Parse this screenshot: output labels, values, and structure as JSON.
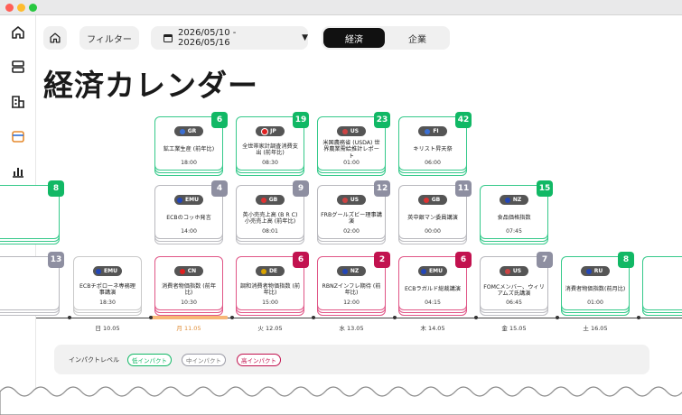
{
  "toolbar": {
    "filter_label": "フィルター",
    "date_range": "2026/05/10 - 2026/05/16",
    "segments": [
      "経済",
      "企業"
    ]
  },
  "page_title": "経済カレンダー",
  "colors": {
    "low": "#11b865",
    "mid": "#8e8fa1",
    "high": "#c2124f",
    "selected_day": "#f7b777"
  },
  "rows": {
    "row1": [
      {
        "flag": "GR",
        "flag_color": "#3b6fd3",
        "title": "鉱工業生産 (前年比)",
        "time": "18:00",
        "count": "6",
        "impact": "low"
      },
      {
        "flag": "JP",
        "flag_color": "#e02020",
        "title": "全世帯家計調査消費支出 (前年比)",
        "time": "08:30",
        "count": "19",
        "impact": "low"
      },
      {
        "flag": "US",
        "flag_color": "#c44",
        "title": "米国農務省 (USDA) 世界農業需給推計レポート",
        "time": "01:00",
        "count": "23",
        "impact": "low"
      },
      {
        "flag": "FI",
        "flag_color": "#3b6fd3",
        "title": "キリスト昇天祭",
        "time": "06:00",
        "count": "42",
        "impact": "low"
      }
    ],
    "row2": [
      {
        "flag": "",
        "flag_color": "#555",
        "title": "",
        "time": "",
        "count": "8",
        "impact": "low"
      },
      {
        "flag": "EMU",
        "flag_color": "#2346b7",
        "title": "ECBのコッホ発言",
        "time": "14:00",
        "count": "4",
        "impact": "mid"
      },
      {
        "flag": "GB",
        "flag_color": "#d33",
        "title": "英小売売上高 (B R C) 小売売上高 (前年比)",
        "time": "08:01",
        "count": "9",
        "impact": "mid"
      },
      {
        "flag": "US",
        "flag_color": "#c44",
        "title": "FRBグールズビー理事講演",
        "time": "02:00",
        "count": "12",
        "impact": "mid"
      },
      {
        "flag": "GB",
        "flag_color": "#d33",
        "title": "英中銀マン委員講演",
        "time": "00:00",
        "count": "11",
        "impact": "mid"
      },
      {
        "flag": "NZ",
        "flag_color": "#2346b7",
        "title": "食品価格指数",
        "time": "07:45",
        "count": "15",
        "impact": "low"
      }
    ],
    "row3": [
      {
        "flag": "",
        "flag_color": "#555",
        "title": "",
        "time": "",
        "count": "13",
        "impact": "mid"
      },
      {
        "flag": "EMU",
        "flag_color": "#2346b7",
        "title": "ECBチポローネ専務理事講演",
        "time": "18:30",
        "count": "",
        "impact": "plain"
      },
      {
        "flag": "CN",
        "flag_color": "#e02020",
        "title": "消費者物価指数 (前年比)",
        "time": "10:30",
        "count": "",
        "impact": "high"
      },
      {
        "flag": "DE",
        "flag_color": "#d9a300",
        "title": "調和消費者物価指数 (前年比)",
        "time": "15:00",
        "count": "6",
        "impact": "high"
      },
      {
        "flag": "NZ",
        "flag_color": "#2346b7",
        "title": "RBNZインフレ期待 (前年比)",
        "time": "12:00",
        "count": "2",
        "impact": "high"
      },
      {
        "flag": "EMU",
        "flag_color": "#2346b7",
        "title": "ECBラガルド総裁講演",
        "time": "04:15",
        "count": "6",
        "impact": "high"
      },
      {
        "flag": "US",
        "flag_color": "#c44",
        "title": "FOMCメンバー、ウィリアムズ氏講演",
        "time": "06:45",
        "count": "7",
        "impact": "mid"
      },
      {
        "flag": "RU",
        "flag_color": "#2346b7",
        "title": "消費者物価指数(前月比)",
        "time": "01:00",
        "count": "8",
        "impact": "low"
      }
    ]
  },
  "days": [
    "日 10.05",
    "月 11.05",
    "火 12.05",
    "水 13.05",
    "木 14.05",
    "金 15.05",
    "土 16.05"
  ],
  "legend": {
    "title": "インパクトレベル",
    "low": "低インパクト",
    "mid": "中インパクト",
    "high": "高インパクト"
  }
}
